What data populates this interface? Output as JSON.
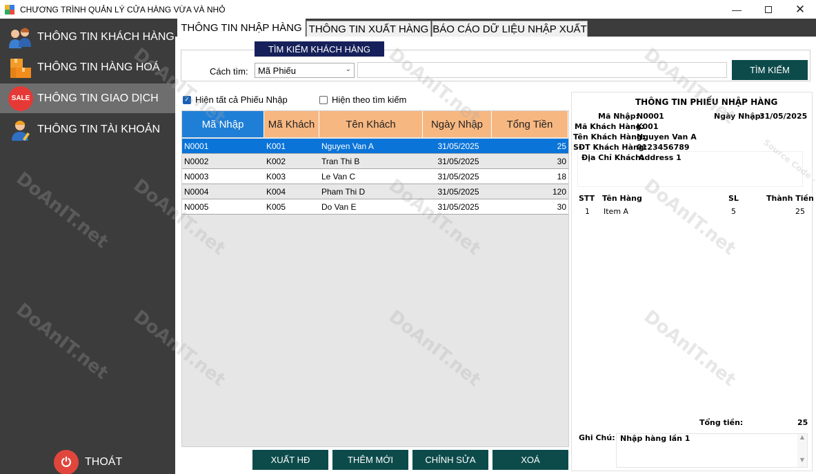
{
  "window": {
    "title": "CHƯƠNG TRÌNH QUẢN LÝ CỬA HÀNG VỪA VÀ NHỎ",
    "min_icon": "minimize-icon",
    "max_icon": "maximize-icon",
    "close_icon": "close-icon"
  },
  "sidebar": {
    "items": [
      {
        "label": "THÔNG TIN KHÁCH HÀNG",
        "icon": "customers-icon"
      },
      {
        "label": "THÔNG TIN HÀNG HOÁ",
        "icon": "boxes-icon"
      },
      {
        "label": "THÔNG TIN GIAO DỊCH",
        "icon": "sale-tag-icon",
        "badge": "SALE"
      },
      {
        "label": "THÔNG TIN TÀI KHOẢN",
        "icon": "account-icon"
      }
    ],
    "exit_label": "THOÁT",
    "exit_icon": "power-icon"
  },
  "tabs": [
    "THÔNG TIN NHẬP HÀNG",
    "THÔNG TIN XUẤT HÀNG",
    "BÁO CÁO DỮ LIỆU NHẬP XUẤT"
  ],
  "search": {
    "group_title": "TÌM KIẾM KHÁCH HÀNG",
    "method_label": "Cách tìm:",
    "method_value": "Mã Phiếu",
    "query_value": "",
    "button": "TÌM KIẾM"
  },
  "filters": {
    "all_label": "Hiện tất cả Phiếu Nhập",
    "search_label": "Hiện theo tìm kiếm"
  },
  "grid": {
    "columns": [
      "Mã Nhập",
      "Mã Khách",
      "Tên Khách",
      "Ngày Nhập",
      "Tổng Tiền"
    ],
    "rows": [
      [
        "N0001",
        "K001",
        "Nguyen Van A",
        "31/05/2025",
        "25"
      ],
      [
        "N0002",
        "K002",
        "Tran Thi B",
        "31/05/2025",
        "30"
      ],
      [
        "N0003",
        "K003",
        "Le Van C",
        "31/05/2025",
        "18"
      ],
      [
        "N0004",
        "K004",
        "Pham Thi D",
        "31/05/2025",
        "120"
      ],
      [
        "N0005",
        "K005",
        "Do Van E",
        "31/05/2025",
        "30"
      ]
    ]
  },
  "actions": {
    "export": "XUẤT HĐ",
    "add": "THÊM MỚI",
    "edit": "CHỈNH SỬA",
    "delete": "XOÁ"
  },
  "receipt": {
    "title": "THÔNG TIN PHIẾU NHẬP HÀNG",
    "ma_nhap_label": "Mã Nhập:",
    "ma_nhap": "N0001",
    "ngay_nhap_label": "Ngày Nhập:",
    "ngay_nhap": "31/05/2025",
    "ma_khach_label": "Mã Khách Hàng:",
    "ma_khach": "K001",
    "ten_khach_label": "Tên Khách Hàng:",
    "ten_khach": "Nguyen Van A",
    "sdt_label": "SĐT Khách Hàng:",
    "sdt": "0123456789",
    "dia_chi_label": "Địa Chỉ Khách:",
    "dia_chi": "Address 1",
    "items_columns": [
      "STT",
      "Tên Hàng",
      "SL",
      "Thành Tiền"
    ],
    "items": [
      [
        "1",
        "Item A",
        "5",
        "25"
      ]
    ],
    "total_label": "Tổng tiền:",
    "total": "25",
    "note_label": "Ghi Chú:",
    "note": "Nhập hàng lần 1"
  },
  "watermark": {
    "text": "DoAnIT.net",
    "subtext": "Source Code - Đồ Án - Bài tập lớn giá rẻ"
  }
}
